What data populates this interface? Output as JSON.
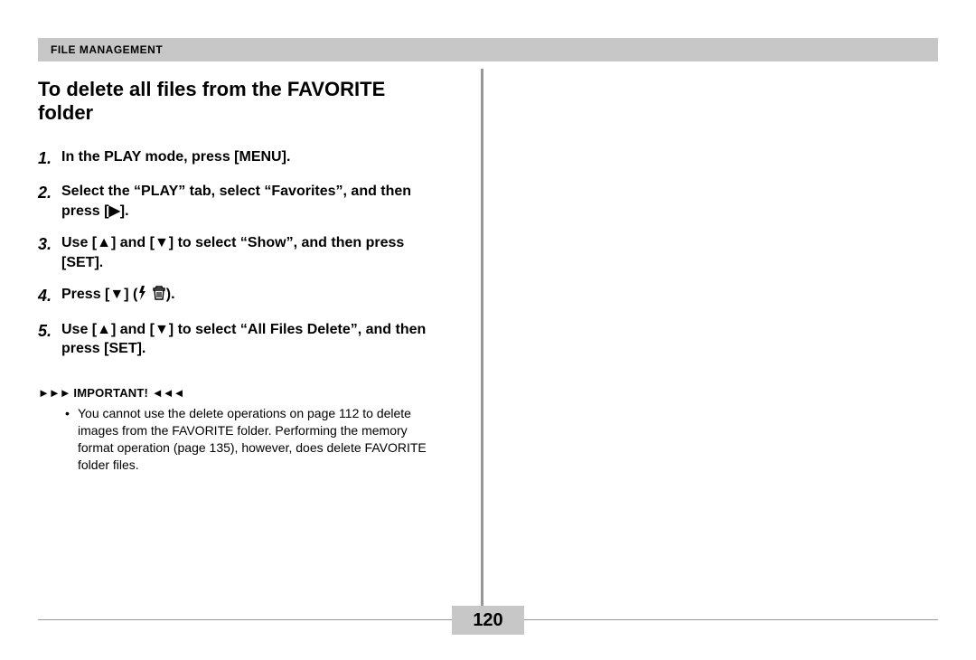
{
  "header": {
    "section": "File Management"
  },
  "title": "To delete all files from the FAVORITE folder",
  "steps": [
    {
      "num": "1.",
      "text": "In the PLAY mode, press [MENU]."
    },
    {
      "num": "2.",
      "text": "Select the “PLAY” tab, select “Favorites”, and then press [▶]."
    },
    {
      "num": "3.",
      "text": "Use [▲] and [▼] to select “Show”, and then press [SET]."
    },
    {
      "num": "4.",
      "pre": "Press [▼] (",
      "post": ")."
    },
    {
      "num": "5.",
      "text": "Use [▲] and [▼] to select “All Files Delete”, and then press [SET]."
    }
  ],
  "important": {
    "label": "IMPORTANT!",
    "items": [
      "You cannot use the delete operations on page 112 to delete images from the FAVORITE folder. Performing the memory format operation (page 135), however, does delete FAVORITE folder files."
    ]
  },
  "page_number": "120"
}
